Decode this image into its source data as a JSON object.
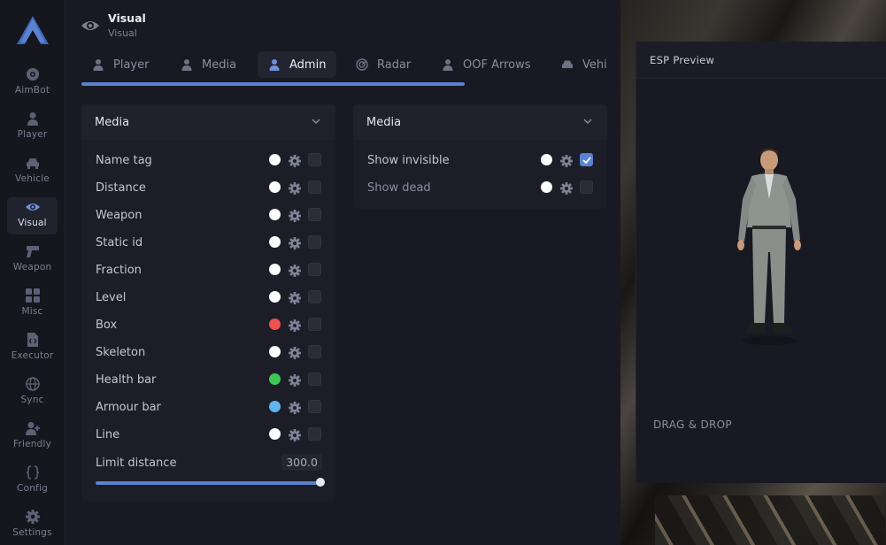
{
  "sidebar": {
    "items": [
      {
        "label": "AimBot",
        "icon": "crosshair-icon"
      },
      {
        "label": "Player",
        "icon": "person-icon"
      },
      {
        "label": "Vehicle",
        "icon": "car-icon"
      },
      {
        "label": "Visual",
        "icon": "eye-icon",
        "active": true
      },
      {
        "label": "Weapon",
        "icon": "gun-icon"
      },
      {
        "label": "Misc",
        "icon": "grid-icon"
      },
      {
        "label": "Executor",
        "icon": "file-icon"
      },
      {
        "label": "Sync",
        "icon": "globe-icon"
      },
      {
        "label": "Friendly",
        "icon": "add-user-icon"
      },
      {
        "label": "Config",
        "icon": "braces-icon"
      },
      {
        "label": "Settings",
        "icon": "gear-icon"
      }
    ]
  },
  "header": {
    "title": "Visual",
    "subtitle": "Visual"
  },
  "tabs": [
    {
      "label": "Player",
      "icon": "person-icon"
    },
    {
      "label": "Media",
      "icon": "person-icon"
    },
    {
      "label": "Admin",
      "icon": "person-icon",
      "active": true
    },
    {
      "label": "Radar",
      "icon": "radar-icon"
    },
    {
      "label": "OOF Arrows",
      "icon": "person-icon"
    },
    {
      "label": "Vehi",
      "icon": "car-icon"
    }
  ],
  "left_card": {
    "title": "Media",
    "rows": [
      {
        "label": "Name tag",
        "color": "#ffffff",
        "checked": false
      },
      {
        "label": "Distance",
        "color": "#ffffff",
        "checked": false
      },
      {
        "label": "Weapon",
        "color": "#ffffff",
        "checked": false
      },
      {
        "label": "Static id",
        "color": "#ffffff",
        "checked": false
      },
      {
        "label": "Fraction",
        "color": "#ffffff",
        "checked": false
      },
      {
        "label": "Level",
        "color": "#ffffff",
        "checked": false
      },
      {
        "label": "Box",
        "color": "#f05050",
        "checked": false
      },
      {
        "label": "Skeleton",
        "color": "#ffffff",
        "checked": false
      },
      {
        "label": "Health bar",
        "color": "#3cc854",
        "checked": false
      },
      {
        "label": "Armour bar",
        "color": "#5fb4ee",
        "checked": false
      },
      {
        "label": "Line",
        "color": "#ffffff",
        "checked": false
      }
    ],
    "limit": {
      "label": "Limit distance",
      "value": "300.0",
      "fraction": 1.0
    }
  },
  "right_card": {
    "title": "Media",
    "rows": [
      {
        "label": "Show invisible",
        "color": "#ffffff",
        "checked": true
      },
      {
        "label": "Show dead",
        "color": "#ffffff",
        "checked": false
      }
    ]
  },
  "preview": {
    "title": "ESP Preview",
    "hint": "DRAG & DROP"
  },
  "colors": {
    "accent": "#5b82d0",
    "panel": "#181922",
    "sidebar": "#15161e"
  }
}
